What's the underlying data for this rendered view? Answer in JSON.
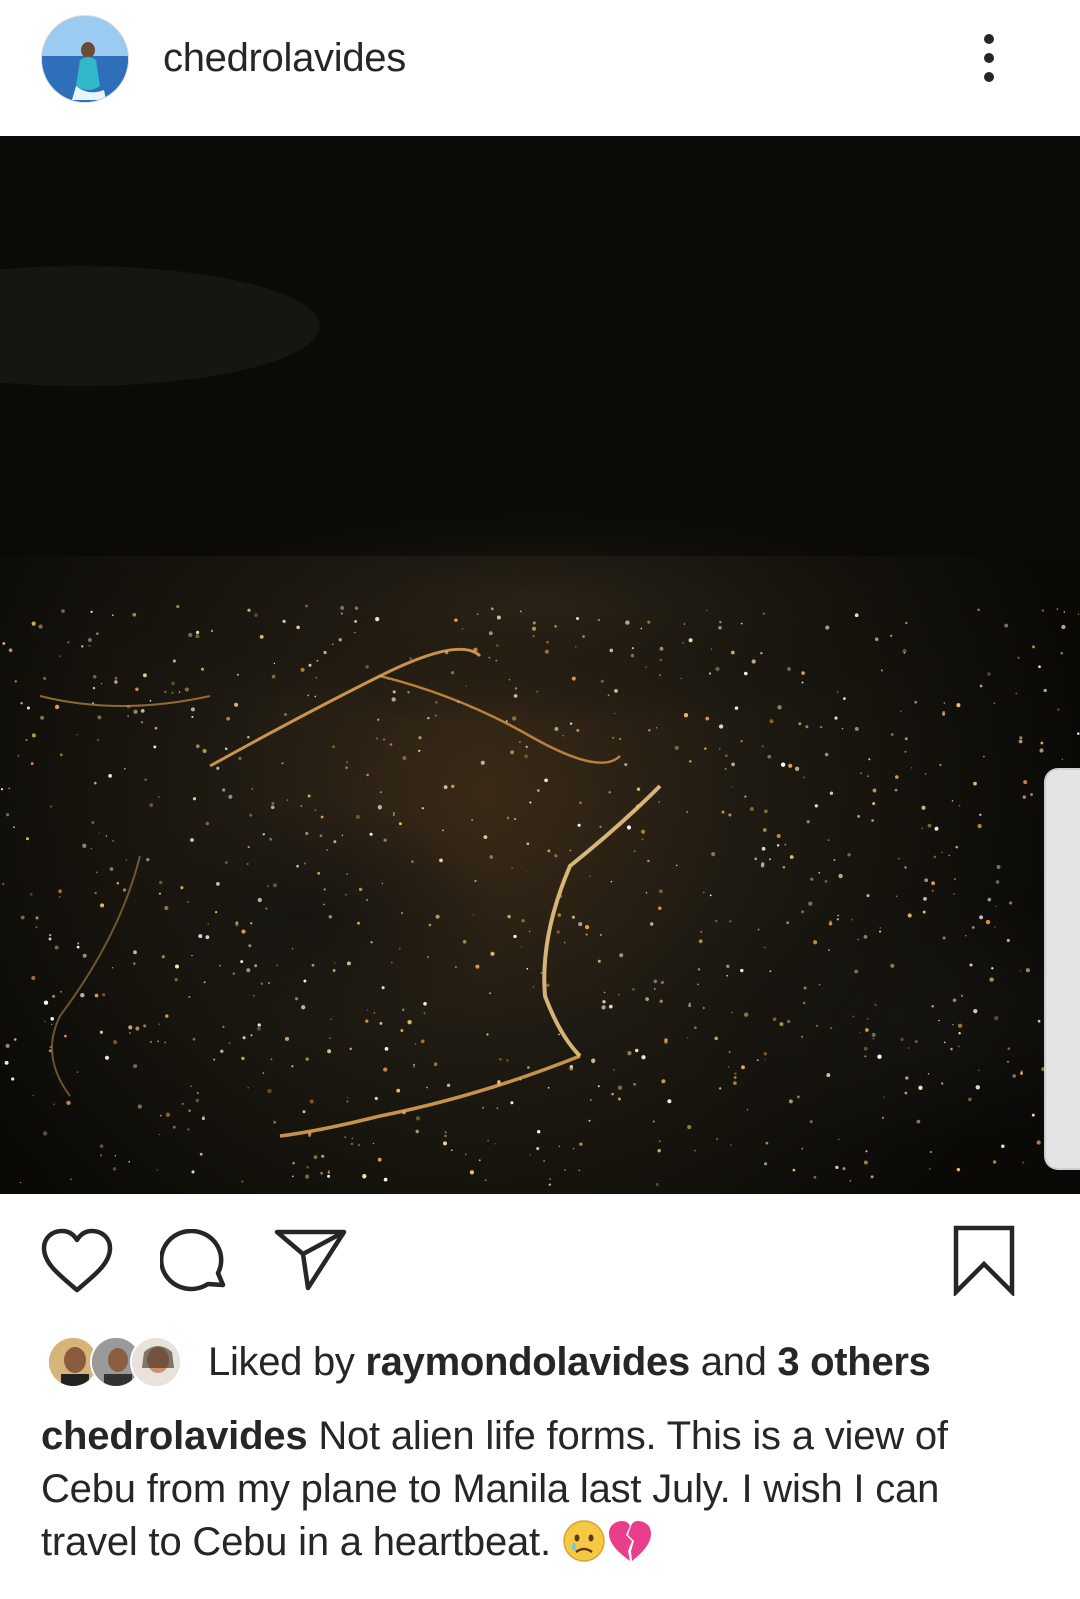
{
  "post": {
    "username": "chedrolavides",
    "more_icon": "more-vertical-icon",
    "photo_description_icon": "user-tag-icon",
    "actions": {
      "like_icon": "heart-icon",
      "comment_icon": "comment-icon",
      "share_icon": "send-icon",
      "save_icon": "bookmark-icon"
    },
    "likes": {
      "prefix": "Liked by ",
      "user": "raymondolavides",
      "connector": " and ",
      "others": "3 others"
    },
    "caption": {
      "username": "chedrolavides",
      "text": "Not alien life forms. This is a view of Cebu from my plane to Manila last July. I wish I can travel to Cebu in a heartbeat.",
      "emojis": [
        "crying-face-emoji",
        "broken-heart-emoji"
      ]
    }
  },
  "colors": {
    "text": "#262626",
    "photo_bg": "#0a0906",
    "city_light": "#f2c46a"
  }
}
